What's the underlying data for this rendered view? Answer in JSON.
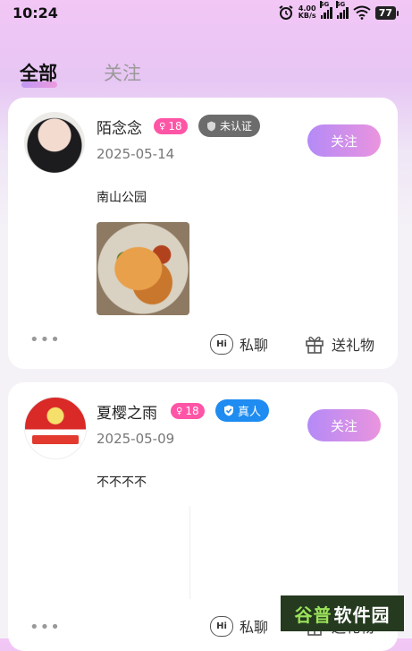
{
  "status_bar": {
    "time": "10:24",
    "speed_value": "4.00",
    "speed_unit": "KB/s",
    "network_1": "5G",
    "network_2": "5G",
    "battery": "77",
    "icons": [
      "alarm-icon",
      "signal-icon",
      "wifi-icon",
      "battery-icon"
    ]
  },
  "tabs": [
    {
      "label": "全部",
      "active": true
    },
    {
      "label": "关注",
      "active": false
    }
  ],
  "posts": [
    {
      "username": "陌念念",
      "age": "18",
      "verify_label": "未认证",
      "date": "2025-05-14",
      "follow_label": "关注",
      "text": "南山公园",
      "chat_label": "私聊",
      "chat_icon_text": "Hi",
      "gift_label": "送礼物"
    },
    {
      "username": "夏樱之雨",
      "age": "18",
      "verify_label": "真人",
      "date": "2025-05-09",
      "follow_label": "关注",
      "text": "不不不不",
      "chat_label": "私聊",
      "chat_icon_text": "Hi",
      "gift_label": "送礼物"
    }
  ],
  "watermark": {
    "part1": "谷普",
    "part2": "软件园"
  },
  "colors": {
    "follow_gradient_start": "#b48af7",
    "follow_gradient_end": "#ea94de",
    "age_badge": "#ff55a6",
    "verified_badge": "#1e8cf0",
    "unverified_badge": "#6c6c6c"
  }
}
